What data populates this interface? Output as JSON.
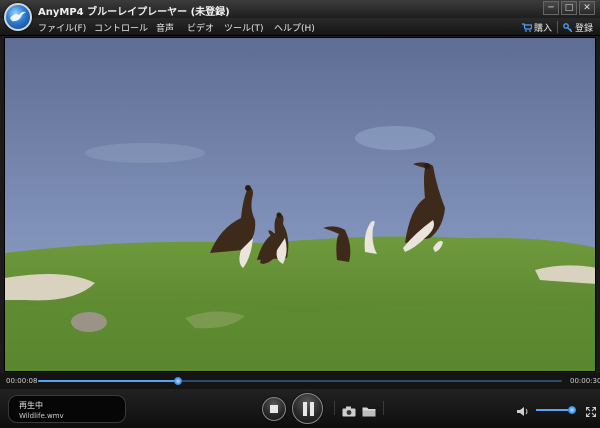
{
  "window": {
    "title": "AnyMP4 ブルーレイプレーヤー (未登録)",
    "buttons": {
      "minimize": "─",
      "maximize": "□",
      "close": "✕"
    }
  },
  "menu": {
    "items": [
      {
        "label": "ファイル(F)"
      },
      {
        "label": "コントロール"
      },
      {
        "label": "音声"
      },
      {
        "label": "ビデオ"
      },
      {
        "label": "ツール(T)"
      },
      {
        "label": "ヘルプ(H)"
      }
    ],
    "purchase": "購入",
    "register": "登録"
  },
  "playback": {
    "current_time": "00:00:08",
    "total_time": "00:00:30",
    "progress_fraction": 0.267,
    "status_text": "再生中",
    "file_name": "Wildlife.wmv",
    "volume_fraction": 0.9
  },
  "icons": {
    "app": "bird-logo-icon",
    "purchase": "cart-icon",
    "register": "key-icon",
    "stop": "stop-icon",
    "pause": "pause-icon",
    "snapshot": "camera-icon",
    "folder": "folder-icon",
    "volume": "speaker-icon",
    "fullscreen": "fullscreen-icon"
  },
  "colors": {
    "accent": "#3a8ee8",
    "background": "#1b1b1b"
  }
}
